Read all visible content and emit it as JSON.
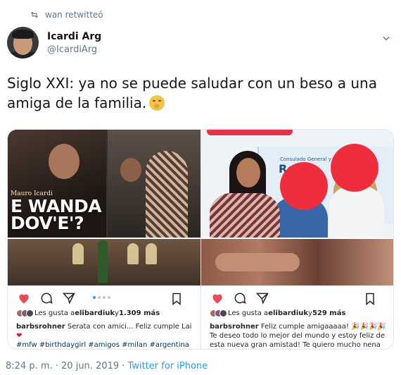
{
  "retweet": {
    "text": "wan retwitteó"
  },
  "author": {
    "display_name": "Icardi Arg",
    "handle": "@IcardiArg"
  },
  "tweet": {
    "text": "Siglo XXI: ya no se puede saludar con un beso a una amiga de la familia."
  },
  "media": {
    "left_post": {
      "magazine_small": "Mauro Icardi",
      "magazine_headline_1": "E WANDA",
      "magazine_headline_2": "DOV'E'?",
      "likes_prefix": "Les gusta a ",
      "likes_user": "elibardiuk",
      "likes_mid": " y ",
      "likes_count": "1.309 más",
      "caption_user": "barbsrohner",
      "caption_text": " Serata con amici... Feliz cumple Lai ",
      "caption_tags": "#mfw #birthdaygirl #amigos #milan #argentina"
    },
    "right_post": {
      "sign_line1": "Consulado General y C",
      "sign_line2": "Re           ina",
      "likes_prefix": "Les gusta a ",
      "likes_user": "elibardiuk",
      "likes_mid": " y ",
      "likes_count": "529 más",
      "caption_user": "barbsrohner",
      "caption_text": " Feliz cumple amigaaaaa! 🎉🎉🎉🎉 Te deseo todo lo mejor del mundo y estoy feliz de esta nueva gran amistad! Te quiero mucho nena 💕"
    }
  },
  "footer": {
    "timestamp": "8:24 p. m. · 20 jun. 2019 · ",
    "source": "Twitter for iPhone"
  },
  "colors": {
    "heart": "#ed4956",
    "link_blue": "#1da1f2",
    "muted": "#657786",
    "blur_red": "#ee2e3c"
  }
}
